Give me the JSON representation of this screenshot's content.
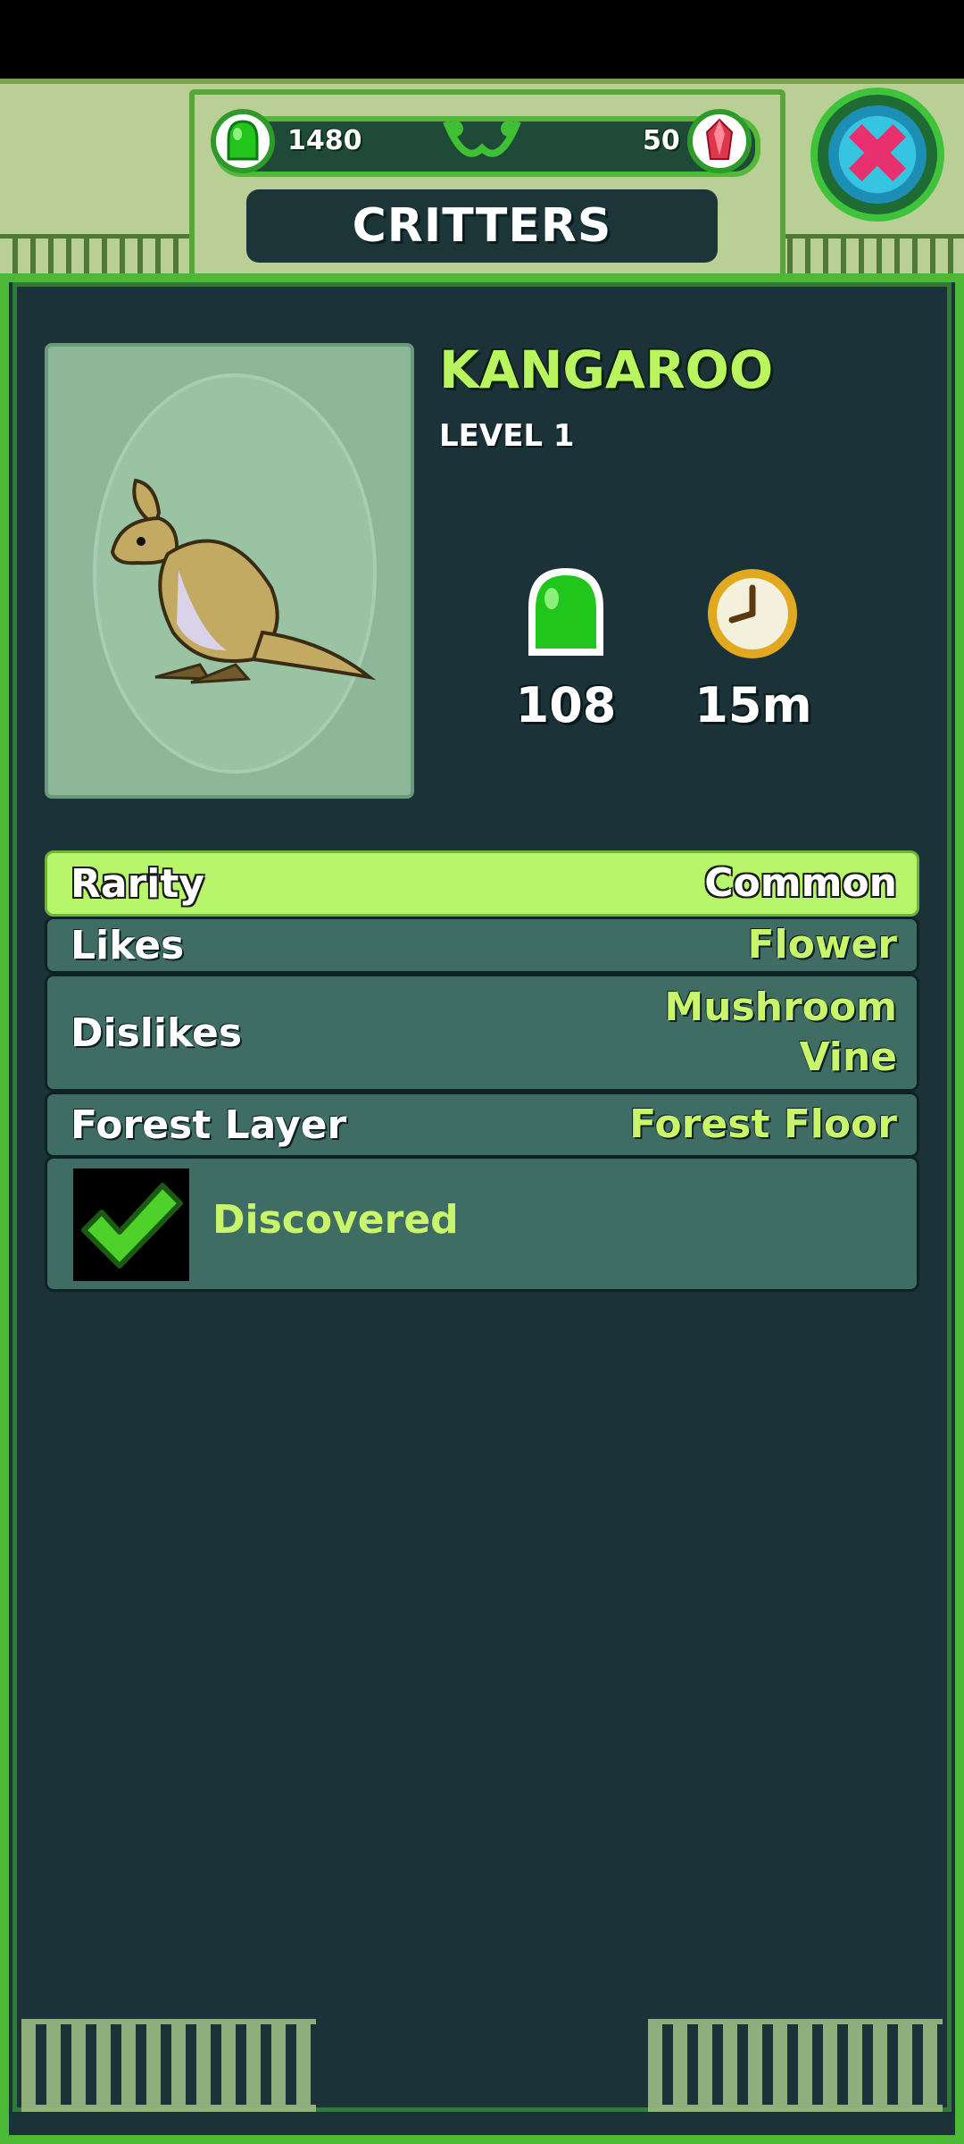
{
  "header": {
    "title": "CRITTERS",
    "currency": {
      "gel": "1480",
      "gems": "50"
    },
    "icons": {
      "gel": "green-gel-icon",
      "gems": "red-crystal-icon",
      "close": "close-x-icon"
    }
  },
  "critter": {
    "name": "KANGAROO",
    "level": "LEVEL 1",
    "portrait": "kangaroo-portrait",
    "stats": {
      "gel": "108",
      "time": "15m"
    }
  },
  "info": {
    "rarity": {
      "label": "Rarity",
      "value": "Common"
    },
    "likes": {
      "label": "Likes",
      "value": "Flower"
    },
    "dislikes": {
      "label": "Dislikes",
      "values": [
        "Mushroom",
        "Vine"
      ]
    },
    "forest_layer": {
      "label": "Forest Layer",
      "value": "Forest Floor"
    },
    "status": {
      "label": "Discovered",
      "icon": "checkmark-icon"
    }
  },
  "colors": {
    "panel": "#1b3238",
    "border": "#4cb936",
    "accent": "#c8f56a",
    "row": "#3f6d64",
    "rarity_row": "#b7f56a"
  }
}
